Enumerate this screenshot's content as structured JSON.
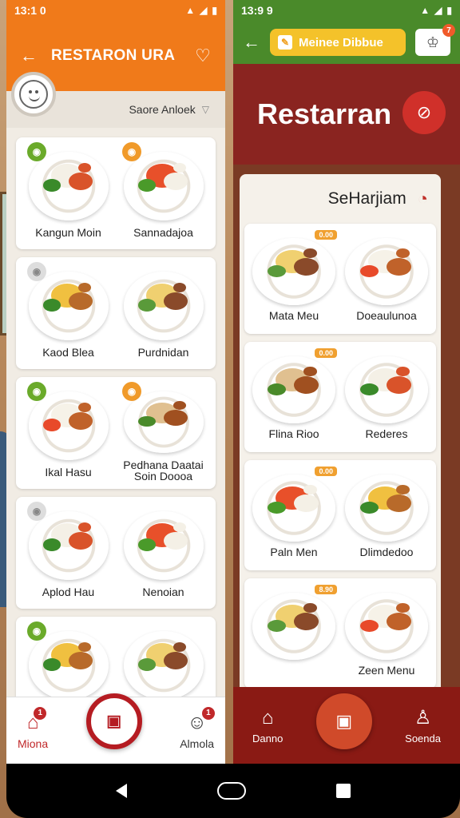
{
  "left": {
    "status": {
      "time": "13:1 0"
    },
    "appbar": {
      "title": "RESTARON URA"
    },
    "sort": {
      "label": "Saore Anloek"
    },
    "cards": [
      {
        "items": [
          {
            "name": "Kangun Moin",
            "badge": "green"
          },
          {
            "name": "Sannadajoa",
            "badge": "orange"
          }
        ]
      },
      {
        "items": [
          {
            "name": "Kaod Blea",
            "badge": "grey"
          },
          {
            "name": "Purdnidan",
            "badge": ""
          }
        ]
      },
      {
        "items": [
          {
            "name": "Ikal Hasu",
            "badge": "green"
          },
          {
            "name": "Pedhana Daatai\nSoin Doooa",
            "badge": "orange"
          }
        ]
      },
      {
        "items": [
          {
            "name": "Aplod Hau",
            "badge": "grey"
          },
          {
            "name": "Nenoian",
            "badge": ""
          }
        ]
      },
      {
        "items": [
          {
            "name": "",
            "badge": "green"
          },
          {
            "name": "",
            "badge": ""
          }
        ]
      }
    ],
    "nav": {
      "home": "Miona",
      "right": "Almola",
      "home_badge": "1",
      "right_badge": "1"
    }
  },
  "right": {
    "status": {
      "time": "13:9 9"
    },
    "appbar": {
      "pill": "Meinee Dibbue",
      "cart_badge": "7"
    },
    "hero": {
      "title": "Restarran"
    },
    "section": {
      "title": "SeHarjiam"
    },
    "cards": [
      {
        "items": [
          {
            "name": "Mata Meu",
            "chip": "0.00"
          },
          {
            "name": "Doeaulunoa",
            "chip": ""
          }
        ]
      },
      {
        "items": [
          {
            "name": "Flina Rioo",
            "chip": "0.00"
          },
          {
            "name": "Rederes",
            "chip": ""
          }
        ]
      },
      {
        "items": [
          {
            "name": "Paln Men",
            "chip": "0.00"
          },
          {
            "name": "Dlimdedoo",
            "chip": ""
          }
        ]
      },
      {
        "items": [
          {
            "name": "",
            "chip": "8.90"
          },
          {
            "name": "Zeen Menu",
            "chip": ""
          }
        ]
      }
    ],
    "nav": {
      "home": "Danno",
      "right": "Soenda"
    }
  }
}
